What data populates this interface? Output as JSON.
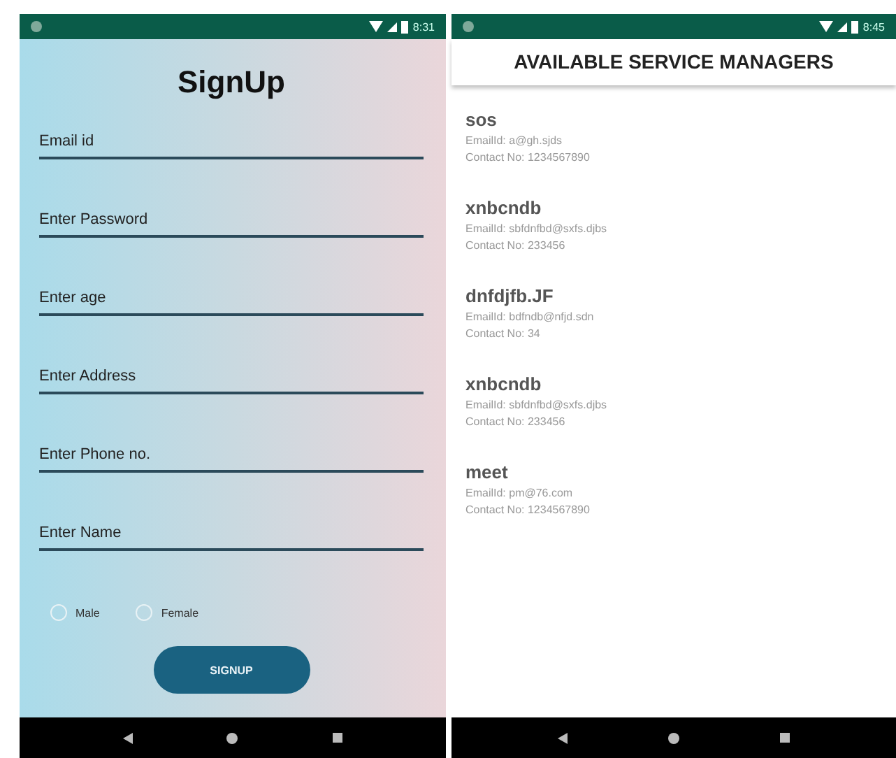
{
  "phones": [
    {
      "status_bar": {
        "time": "8:31"
      },
      "signup": {
        "title": "SignUp",
        "fields": [
          {
            "placeholder": "Email id"
          },
          {
            "placeholder": "Enter Password"
          },
          {
            "placeholder": "Enter age"
          },
          {
            "placeholder": "Enter Address"
          },
          {
            "placeholder": "Enter Phone no."
          },
          {
            "placeholder": "Enter Name"
          }
        ],
        "gender": [
          {
            "label": "Male",
            "selected": false
          },
          {
            "label": "Female",
            "selected": false
          }
        ],
        "button": "SIGNUP"
      }
    },
    {
      "status_bar": {
        "time": "8:45"
      },
      "managers": {
        "title": "AVAILABLE SERVICE MANAGERS",
        "items": [
          {
            "name": "sos",
            "email": "EmailId: a@gh.sjds",
            "contact": "Contact No: 1234567890"
          },
          {
            "name": "xnbcndb",
            "email": "EmailId: sbfdnfbd@sxfs.djbs",
            "contact": "Contact No: 233456"
          },
          {
            "name": "dnfdjfb.JF",
            "email": "EmailId: bdfndb@nfjd.sdn",
            "contact": "Contact No: 34"
          },
          {
            "name": "xnbcndb",
            "email": "EmailId: sbfdnfbd@sxfs.djbs",
            "contact": "Contact No: 233456"
          },
          {
            "name": "meet",
            "email": "EmailId: pm@76.com",
            "contact": "Contact No: 1234567890"
          }
        ]
      }
    }
  ]
}
